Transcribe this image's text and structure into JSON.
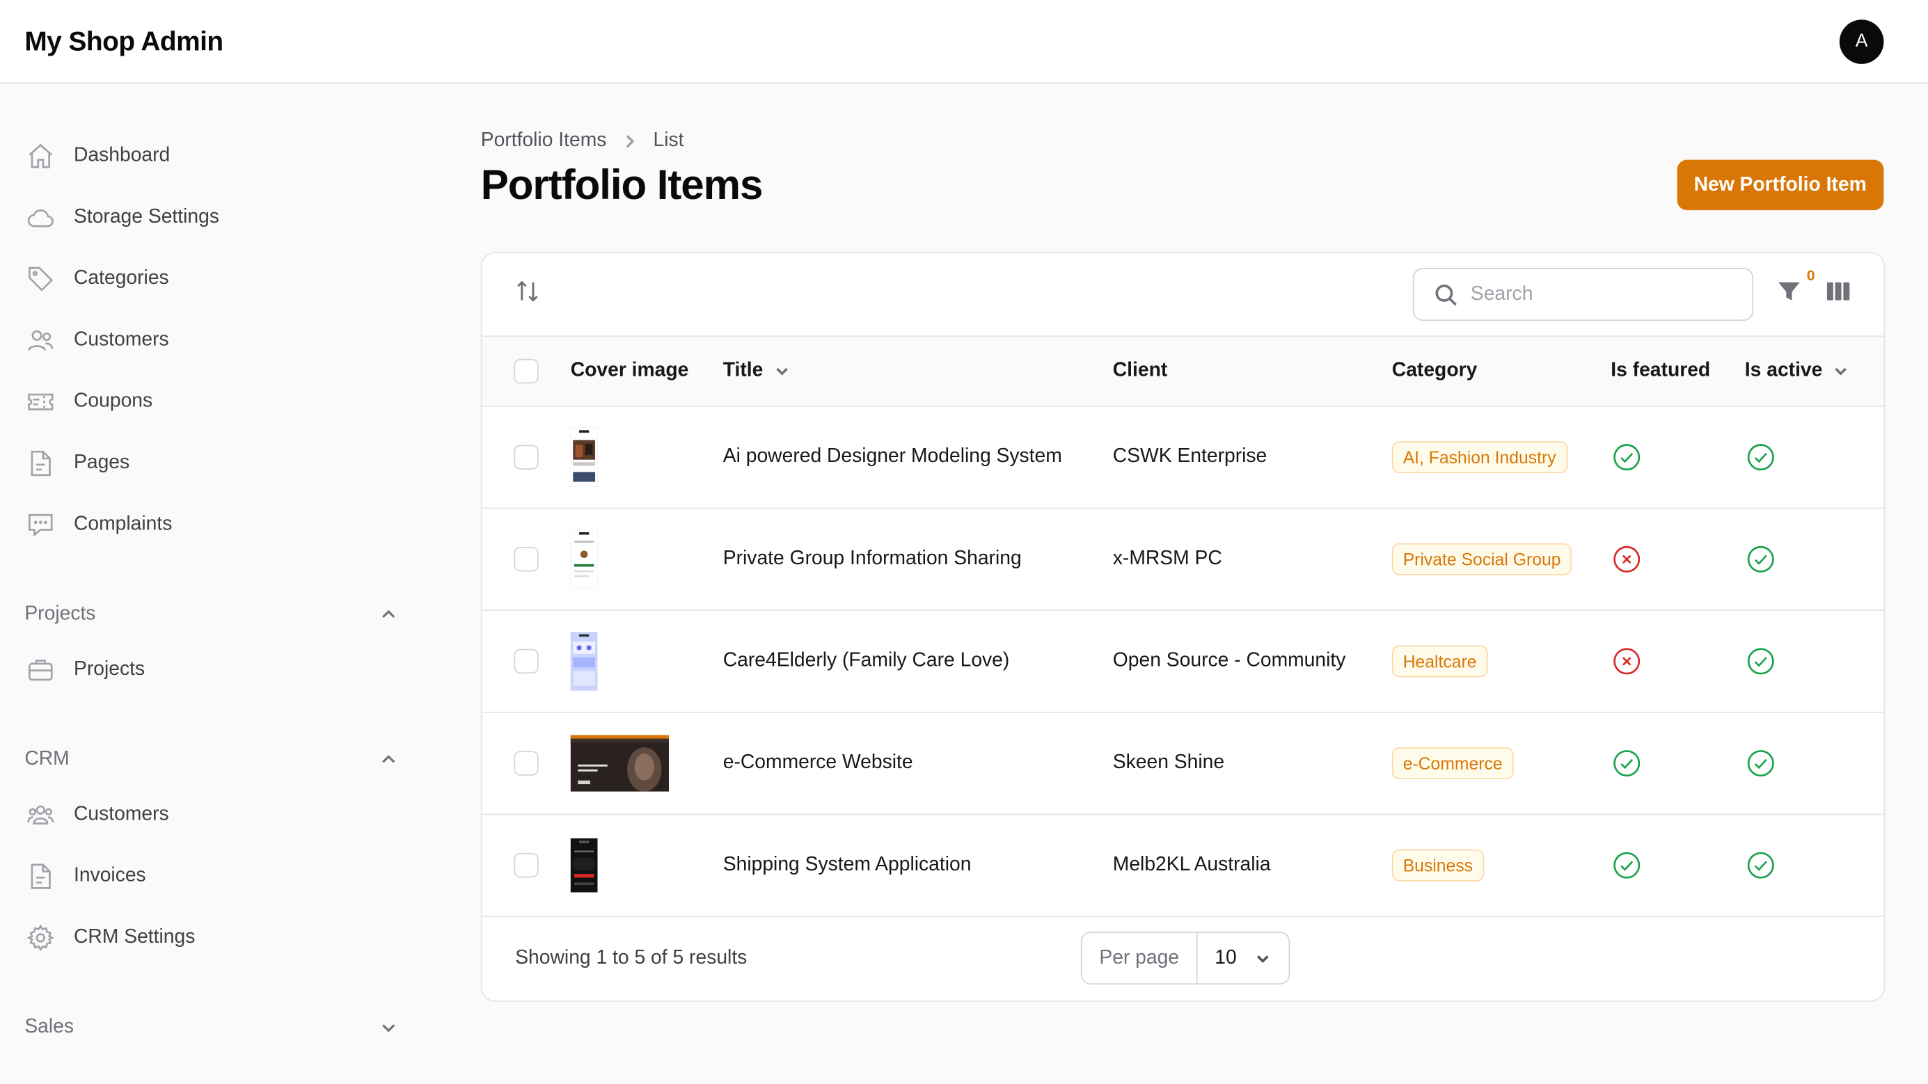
{
  "app": {
    "title": "My Shop Admin",
    "user_initial": "A"
  },
  "sidebar": {
    "items": [
      {
        "label": "Dashboard",
        "icon": "home-icon"
      },
      {
        "label": "Storage Settings",
        "icon": "cloud-icon"
      },
      {
        "label": "Categories",
        "icon": "tag-icon"
      },
      {
        "label": "Customers",
        "icon": "users-icon"
      },
      {
        "label": "Coupons",
        "icon": "ticket-icon"
      },
      {
        "label": "Pages",
        "icon": "document-icon"
      },
      {
        "label": "Complaints",
        "icon": "chat-icon"
      }
    ],
    "groups": [
      {
        "label": "Projects",
        "expanded": true,
        "items": [
          {
            "label": "Projects",
            "icon": "briefcase-icon"
          }
        ]
      },
      {
        "label": "CRM",
        "expanded": true,
        "items": [
          {
            "label": "Customers",
            "icon": "user-group-icon"
          },
          {
            "label": "Invoices",
            "icon": "document-icon"
          },
          {
            "label": "CRM Settings",
            "icon": "gear-icon"
          }
        ]
      },
      {
        "label": "Sales",
        "expanded": false,
        "items": []
      }
    ]
  },
  "breadcrumb": {
    "parent": "Portfolio Items",
    "current": "List"
  },
  "page": {
    "title": "Portfolio Items",
    "new_button": "New Portfolio Item"
  },
  "toolbar": {
    "search_placeholder": "Search",
    "filter_count": "0"
  },
  "table": {
    "columns": {
      "cover": "Cover image",
      "title": "Title",
      "client": "Client",
      "category": "Category",
      "featured": "Is featured",
      "active": "Is active"
    },
    "rows": [
      {
        "title": "Ai powered Designer Modeling System",
        "client": "CSWK Enterprise",
        "category": "AI, Fashion Industry",
        "featured": true,
        "active": true
      },
      {
        "title": "Private Group Information Sharing",
        "client": "x-MRSM PC",
        "category": "Private Social Group",
        "featured": false,
        "active": true
      },
      {
        "title": "Care4Elderly (Family Care Love)",
        "client": "Open Source - Community",
        "category": "Healtcare",
        "featured": false,
        "active": true
      },
      {
        "title": "e-Commerce Website",
        "client": "Skeen Shine",
        "category": "e-Commerce",
        "featured": true,
        "active": true
      },
      {
        "title": "Shipping System Application",
        "client": "Melb2KL Australia",
        "category": "Business",
        "featured": true,
        "active": true
      }
    ]
  },
  "footer": {
    "showing": "Showing 1 to 5 of 5 results",
    "per_page_label": "Per page",
    "per_page_value": "10"
  },
  "colors": {
    "accent": "#d97706",
    "success": "#16a34a",
    "danger": "#dc2626"
  }
}
